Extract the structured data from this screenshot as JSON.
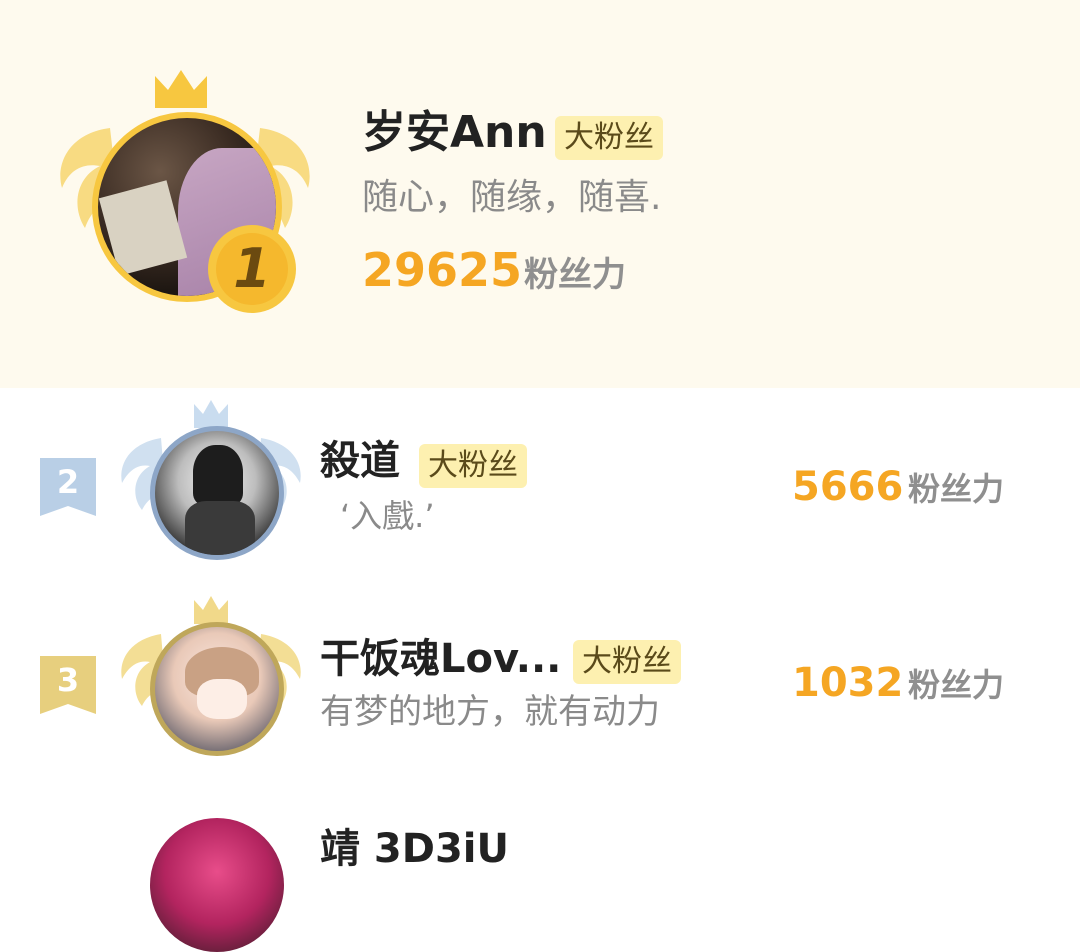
{
  "ranking": {
    "first": {
      "rank": "1",
      "name": "岁安Ann",
      "badge": "大粉丝",
      "motto": "随心，随缘，随喜.",
      "score": "29625",
      "score_unit": "粉丝力"
    },
    "rows": [
      {
        "rank": "2",
        "name": "殺道",
        "badge": "大粉丝",
        "motto": "‘入戲.’",
        "score": "5666",
        "score_unit": "粉丝力"
      },
      {
        "rank": "3",
        "name": "干饭魂Lov...",
        "badge": "大粉丝",
        "motto": "有梦的地方，就有动力",
        "score": "1032",
        "score_unit": "粉丝力"
      },
      {
        "name": "靖 3D3iU"
      }
    ]
  },
  "colors": {
    "top_bg": "#fefaee",
    "score": "#f5a623",
    "gold": "#f7c740",
    "silver": "#b9cfe6",
    "bronze": "#e7cf7e",
    "badge_bg": "#fdf0b0"
  },
  "icons": [
    "crown-icon",
    "wings-icon",
    "rank-medal-icon",
    "rank-ribbon-icon"
  ]
}
